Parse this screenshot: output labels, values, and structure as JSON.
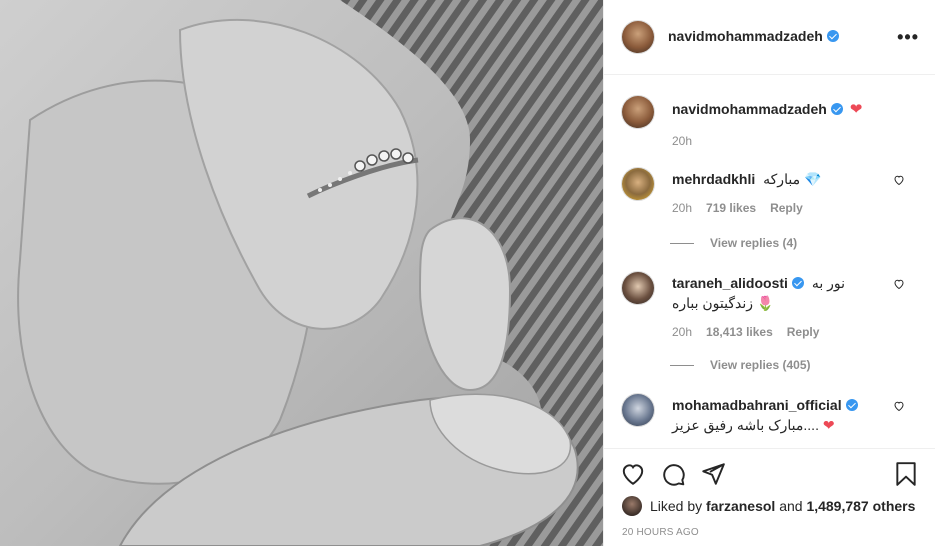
{
  "post": {
    "author": "navidmohammadzadeh",
    "author_verified": true,
    "more_options_glyph": "•••",
    "caption": {
      "emoji": "❤",
      "time": "20h"
    }
  },
  "comments": [
    {
      "username": "mehrdadkhli",
      "verified": false,
      "text": "مبارکه",
      "emoji": "💎",
      "time": "20h",
      "likes": "719 likes",
      "reply_label": "Reply",
      "view_replies": "View replies (4)"
    },
    {
      "username": "taraneh_alidoosti",
      "verified": true,
      "text_line1": "نور به",
      "text_line2": "زندگیتون بباره",
      "emoji": "🌷",
      "time": "20h",
      "likes": "18,413 likes",
      "reply_label": "Reply",
      "view_replies": "View replies (405)"
    },
    {
      "username": "mohamadbahrani_official",
      "verified": true,
      "text": "مبارک باشه رفیق عزیز....",
      "emoji": "❤"
    }
  ],
  "actions": {
    "liked_by_prefix": "Liked by",
    "liked_by_user": "farzanesol",
    "liked_by_and": "and",
    "likes_count": "1,489,787 others",
    "time_ago": "20 HOURS AGO"
  },
  "icons": [
    "heart-icon",
    "comment-icon",
    "share-icon",
    "bookmark-icon",
    "more-options-icon",
    "verified-badge-icon"
  ],
  "colors": {
    "verified": "#3897f0",
    "heart_red": "#ed4956",
    "meta_gray": "#8e8e8e",
    "divider": "#efefef"
  }
}
